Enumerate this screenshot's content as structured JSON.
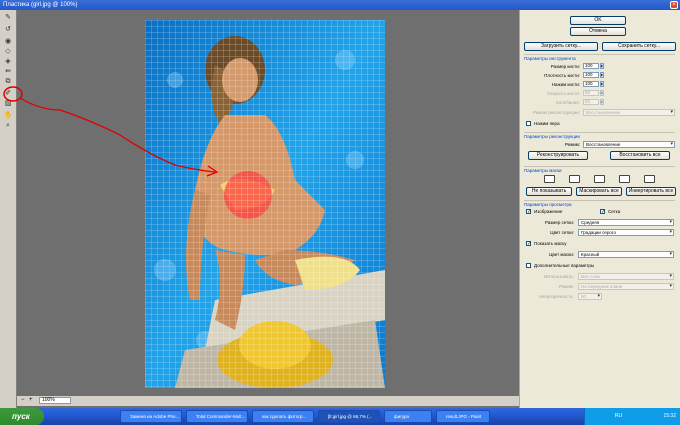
{
  "window": {
    "title": "Пластика (girl.jpg @ 100%)"
  },
  "toolbar": {
    "tools": [
      "warp-icon",
      "reconstruct-icon",
      "twirl-icon",
      "pucker-icon",
      "bloat-icon",
      "push-left-icon",
      "mirror-icon",
      "freeze-mask-icon",
      "thaw-mask-icon",
      "hand-icon",
      "zoom-icon"
    ]
  },
  "bottom": {
    "zoom": "100%"
  },
  "panel": {
    "ok": "OK",
    "cancel": "Отмена",
    "load_mesh": "Загрузить сетку...",
    "save_mesh": "Сохранить сетку...",
    "tool_options_title": "Параметры инструмента",
    "brush_size_label": "Размер кисти:",
    "brush_size": "100",
    "brush_density_label": "Плотность кисти:",
    "brush_density": "100",
    "brush_pressure_label": "Нажим кисти:",
    "brush_pressure": "100",
    "brush_rate_label": "Скорость кисти:",
    "brush_rate": "80",
    "turbulent_jitter_label": "Колебание:",
    "turbulent_jitter": "50",
    "reconstruct_mode_label": "Режим реконструкции:",
    "reconstruct_mode": "Восстановление",
    "stylus_pressure": "Нажим пера",
    "reconstruct_options_title": "Параметры реконструкции",
    "mode_label": "Режим:",
    "mode": "Восстановление",
    "reconstruct": "Реконструировать",
    "restore_all": "Восстановить все",
    "mask_options_title": "Параметры маски",
    "none": "Не показывать",
    "mask_all": "Маскировать все",
    "invert_all": "Инвертировать все",
    "view_options_title": "Параметры просмотра",
    "show_image": "Изображение",
    "show_mesh": "Сетка",
    "mesh_size_label": "Размер сетки:",
    "mesh_size": "Средняя",
    "mesh_color_label": "Цвет сетки:",
    "mesh_color": "Градации серого",
    "show_mask": "Показать маску",
    "mask_color_label": "Цвет маски:",
    "mask_color": "Красный",
    "show_backdrop": "Дополнительные параметры",
    "use_label": "Использовать:",
    "use": "Все слои",
    "backdrop_mode_label": "Режим:",
    "backdrop_mode": "На переднем плане",
    "opacity_label": "Непрозрачность:",
    "opacity": "50"
  },
  "taskbar": {
    "start": "пуск",
    "tasks": [
      "Замена на Adobe Pho...",
      "Total Commander-Mult...",
      "как сделать фотогр...",
      "[lt:girl.jpg @ 66,7% (...",
      "фигура",
      "result.JPG - Paint"
    ],
    "lang": "RU",
    "clock": "15:32"
  },
  "colors": {
    "accent": "#0046d5",
    "mask": "#ff3a3a",
    "pool": "#1d8fd8"
  }
}
